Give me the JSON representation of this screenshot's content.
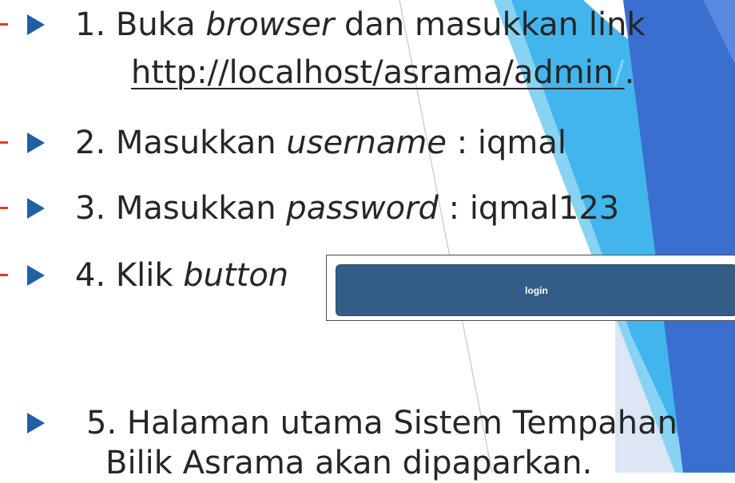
{
  "steps": [
    {
      "num": "1. Buka ",
      "em": "browser",
      "rest": " dan masukkan link",
      "link_text": "http://localhost/asrama/admin",
      "link_slash": "/",
      "link_end": "."
    },
    {
      "num": "2. Masukkan ",
      "em": "username",
      "rest": " : iqmal"
    },
    {
      "num": "3. Masukkan ",
      "em": "password",
      "rest": " : iqmal123"
    },
    {
      "num": "4. Klik ",
      "em": "button"
    },
    {
      "line1": "5. Halaman utama Sistem Tempahan",
      "line2": "Bilik Asrama akan dipaparkan."
    }
  ],
  "login_button": {
    "label": "login"
  },
  "colors": {
    "bullet": "#1f5fa8",
    "marker": "#e23b2e",
    "button": "#335d87",
    "sky": "#42b5ec",
    "royal": "#3a6fd0"
  }
}
